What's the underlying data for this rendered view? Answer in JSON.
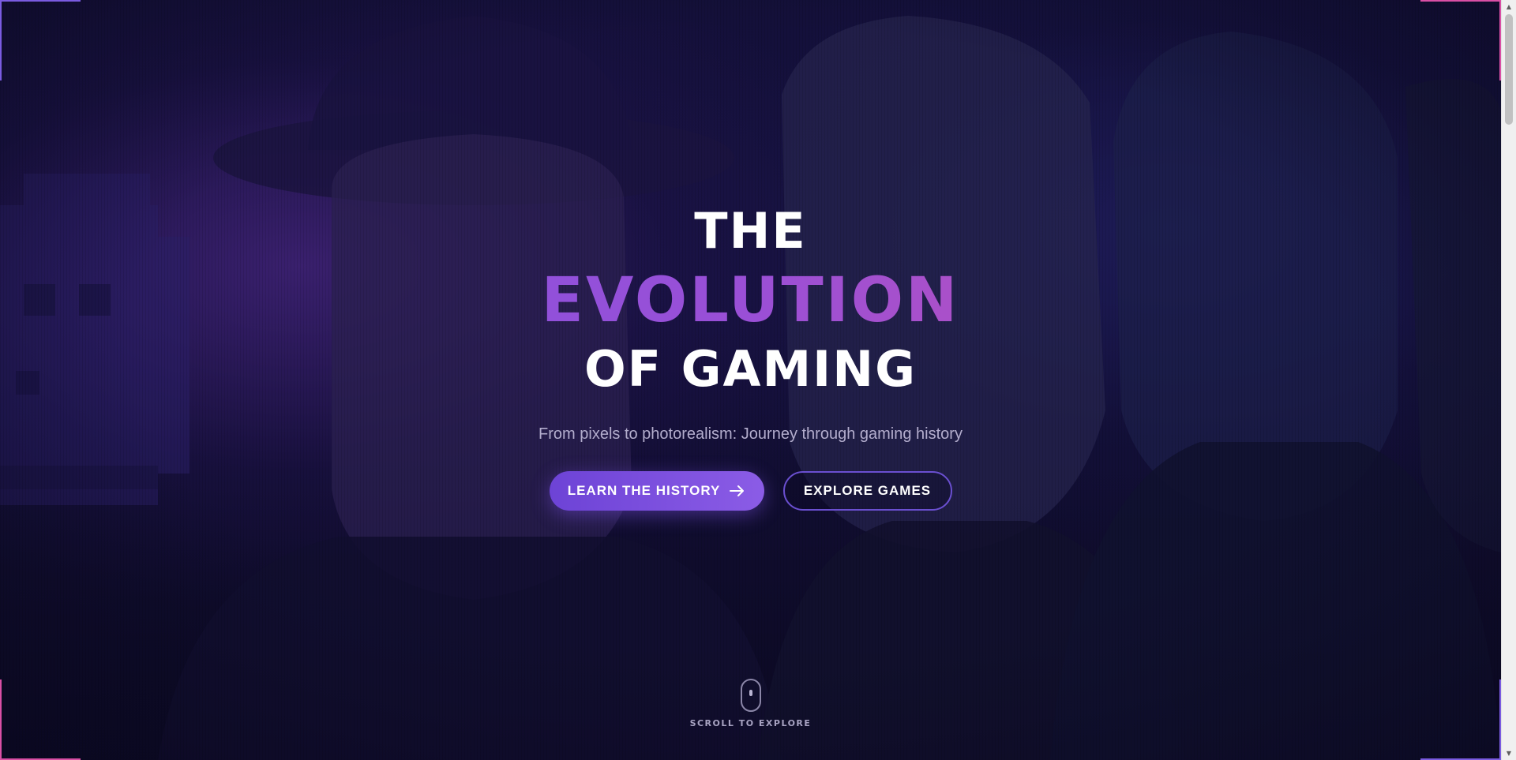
{
  "hero": {
    "title_line1": "THE",
    "title_line2": "EVOLUTION",
    "title_line3": "OF GAMING",
    "subtitle": "From pixels to photorealism: Journey through gaming history",
    "primary_button": "LEARN THE HISTORY",
    "secondary_button": "EXPLORE GAMES"
  },
  "scroll_indicator": {
    "label": "SCROLL TO EXPLORE"
  },
  "colors": {
    "accent_purple": "#7b53e6",
    "accent_pink": "#d454a8",
    "background": "#14103a"
  },
  "icons": {
    "primary_button_icon": "arrow-right-icon",
    "scroll_icon": "mouse-icon"
  }
}
